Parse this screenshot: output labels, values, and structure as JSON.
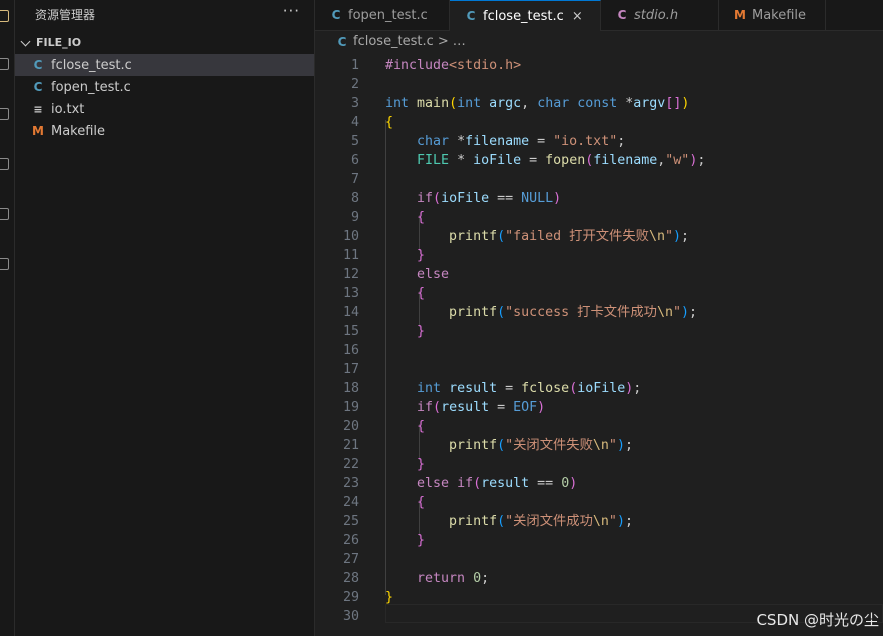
{
  "explorer": {
    "title": "资源管理器",
    "more": "···",
    "folder": "FILE_IO",
    "files": [
      {
        "name": "fclose_test.c",
        "icon": "C",
        "selected": true
      },
      {
        "name": "fopen_test.c",
        "icon": "C",
        "selected": false
      },
      {
        "name": "io.txt",
        "icon": "≡",
        "selected": false
      },
      {
        "name": "Makefile",
        "icon": "M",
        "selected": false
      }
    ]
  },
  "tabs": [
    {
      "label": "fopen_test.c",
      "icon": "C",
      "active": false
    },
    {
      "label": "fclose_test.c",
      "icon": "C",
      "active": true,
      "close": "×"
    },
    {
      "label": "stdio.h",
      "icon": "C",
      "active": false
    },
    {
      "label": "Makefile",
      "icon": "M",
      "active": false
    }
  ],
  "breadcrumb": {
    "file": "fclose_test.c",
    "sep": ">",
    "rest": "…"
  },
  "editor": {
    "lines": [
      [
        [
          "kc",
          "#include"
        ],
        [
          "str",
          "<stdio.h>"
        ]
      ],
      [],
      [
        [
          "kw",
          "int"
        ],
        [
          "plain",
          " "
        ],
        [
          "fn",
          "main"
        ],
        [
          "p1",
          "("
        ],
        [
          "kw",
          "int"
        ],
        [
          "plain",
          " "
        ],
        [
          "var",
          "argc"
        ],
        [
          "plain",
          ", "
        ],
        [
          "kw",
          "char"
        ],
        [
          "plain",
          " "
        ],
        [
          "kw",
          "const"
        ],
        [
          "plain",
          " *"
        ],
        [
          "var",
          "argv"
        ],
        [
          "p2",
          "[]"
        ],
        [
          "p1",
          ")"
        ]
      ],
      [
        [
          "p1",
          "{"
        ]
      ],
      [
        [
          "plain",
          "    "
        ],
        [
          "kw",
          "char"
        ],
        [
          "plain",
          " *"
        ],
        [
          "var",
          "filename"
        ],
        [
          "plain",
          " = "
        ],
        [
          "str",
          "\"io.txt\""
        ],
        [
          "plain",
          ";"
        ]
      ],
      [
        [
          "plain",
          "    "
        ],
        [
          "ty",
          "FILE"
        ],
        [
          "plain",
          " * "
        ],
        [
          "var",
          "ioFile"
        ],
        [
          "plain",
          " = "
        ],
        [
          "fn",
          "fopen"
        ],
        [
          "p2",
          "("
        ],
        [
          "var",
          "filename"
        ],
        [
          "plain",
          ","
        ],
        [
          "str",
          "\"w\""
        ],
        [
          "p2",
          ")"
        ],
        [
          "plain",
          ";"
        ]
      ],
      [],
      [
        [
          "plain",
          "    "
        ],
        [
          "kc",
          "if"
        ],
        [
          "p2",
          "("
        ],
        [
          "var",
          "ioFile"
        ],
        [
          "plain",
          " == "
        ],
        [
          "kw",
          "NULL"
        ],
        [
          "p2",
          ")"
        ]
      ],
      [
        [
          "plain",
          "    "
        ],
        [
          "p2",
          "{"
        ]
      ],
      [
        [
          "plain",
          "        "
        ],
        [
          "fn",
          "printf"
        ],
        [
          "p3",
          "("
        ],
        [
          "str",
          "\"failed 打开文件失败"
        ],
        [
          "esc",
          "\\n"
        ],
        [
          "str",
          "\""
        ],
        [
          "p3",
          ")"
        ],
        [
          "plain",
          ";"
        ]
      ],
      [
        [
          "plain",
          "    "
        ],
        [
          "p2",
          "}"
        ]
      ],
      [
        [
          "plain",
          "    "
        ],
        [
          "kc",
          "else"
        ]
      ],
      [
        [
          "plain",
          "    "
        ],
        [
          "p2",
          "{"
        ]
      ],
      [
        [
          "plain",
          "        "
        ],
        [
          "fn",
          "printf"
        ],
        [
          "p3",
          "("
        ],
        [
          "str",
          "\"success 打卡文件成功"
        ],
        [
          "esc",
          "\\n"
        ],
        [
          "str",
          "\""
        ],
        [
          "p3",
          ")"
        ],
        [
          "plain",
          ";"
        ]
      ],
      [
        [
          "plain",
          "    "
        ],
        [
          "p2",
          "}"
        ]
      ],
      [],
      [],
      [
        [
          "plain",
          "    "
        ],
        [
          "kw",
          "int"
        ],
        [
          "plain",
          " "
        ],
        [
          "var",
          "result"
        ],
        [
          "plain",
          " = "
        ],
        [
          "fn",
          "fclose"
        ],
        [
          "p2",
          "("
        ],
        [
          "var",
          "ioFile"
        ],
        [
          "p2",
          ")"
        ],
        [
          "plain",
          ";"
        ]
      ],
      [
        [
          "plain",
          "    "
        ],
        [
          "kc",
          "if"
        ],
        [
          "p2",
          "("
        ],
        [
          "var",
          "result"
        ],
        [
          "plain",
          " = "
        ],
        [
          "kw",
          "EOF"
        ],
        [
          "p2",
          ")"
        ]
      ],
      [
        [
          "plain",
          "    "
        ],
        [
          "p2",
          "{"
        ]
      ],
      [
        [
          "plain",
          "        "
        ],
        [
          "fn",
          "printf"
        ],
        [
          "p3",
          "("
        ],
        [
          "str",
          "\"关闭文件失败"
        ],
        [
          "esc",
          "\\n"
        ],
        [
          "str",
          "\""
        ],
        [
          "p3",
          ")"
        ],
        [
          "plain",
          ";"
        ]
      ],
      [
        [
          "plain",
          "    "
        ],
        [
          "p2",
          "}"
        ]
      ],
      [
        [
          "plain",
          "    "
        ],
        [
          "kc",
          "else"
        ],
        [
          "plain",
          " "
        ],
        [
          "kc",
          "if"
        ],
        [
          "p2",
          "("
        ],
        [
          "var",
          "result"
        ],
        [
          "plain",
          " == "
        ],
        [
          "num",
          "0"
        ],
        [
          "p2",
          ")"
        ]
      ],
      [
        [
          "plain",
          "    "
        ],
        [
          "p2",
          "{"
        ]
      ],
      [
        [
          "plain",
          "        "
        ],
        [
          "fn",
          "printf"
        ],
        [
          "p3",
          "("
        ],
        [
          "str",
          "\"关闭文件成功"
        ],
        [
          "esc",
          "\\n"
        ],
        [
          "str",
          "\""
        ],
        [
          "p3",
          ")"
        ],
        [
          "plain",
          ";"
        ]
      ],
      [
        [
          "plain",
          "    "
        ],
        [
          "p2",
          "}"
        ]
      ],
      [],
      [
        [
          "plain",
          "    "
        ],
        [
          "kc",
          "return"
        ],
        [
          "plain",
          " "
        ],
        [
          "num",
          "0"
        ],
        [
          "plain",
          ";"
        ]
      ],
      [
        [
          "p1",
          "}"
        ]
      ],
      []
    ]
  },
  "watermark": "CSDN @时光の尘"
}
